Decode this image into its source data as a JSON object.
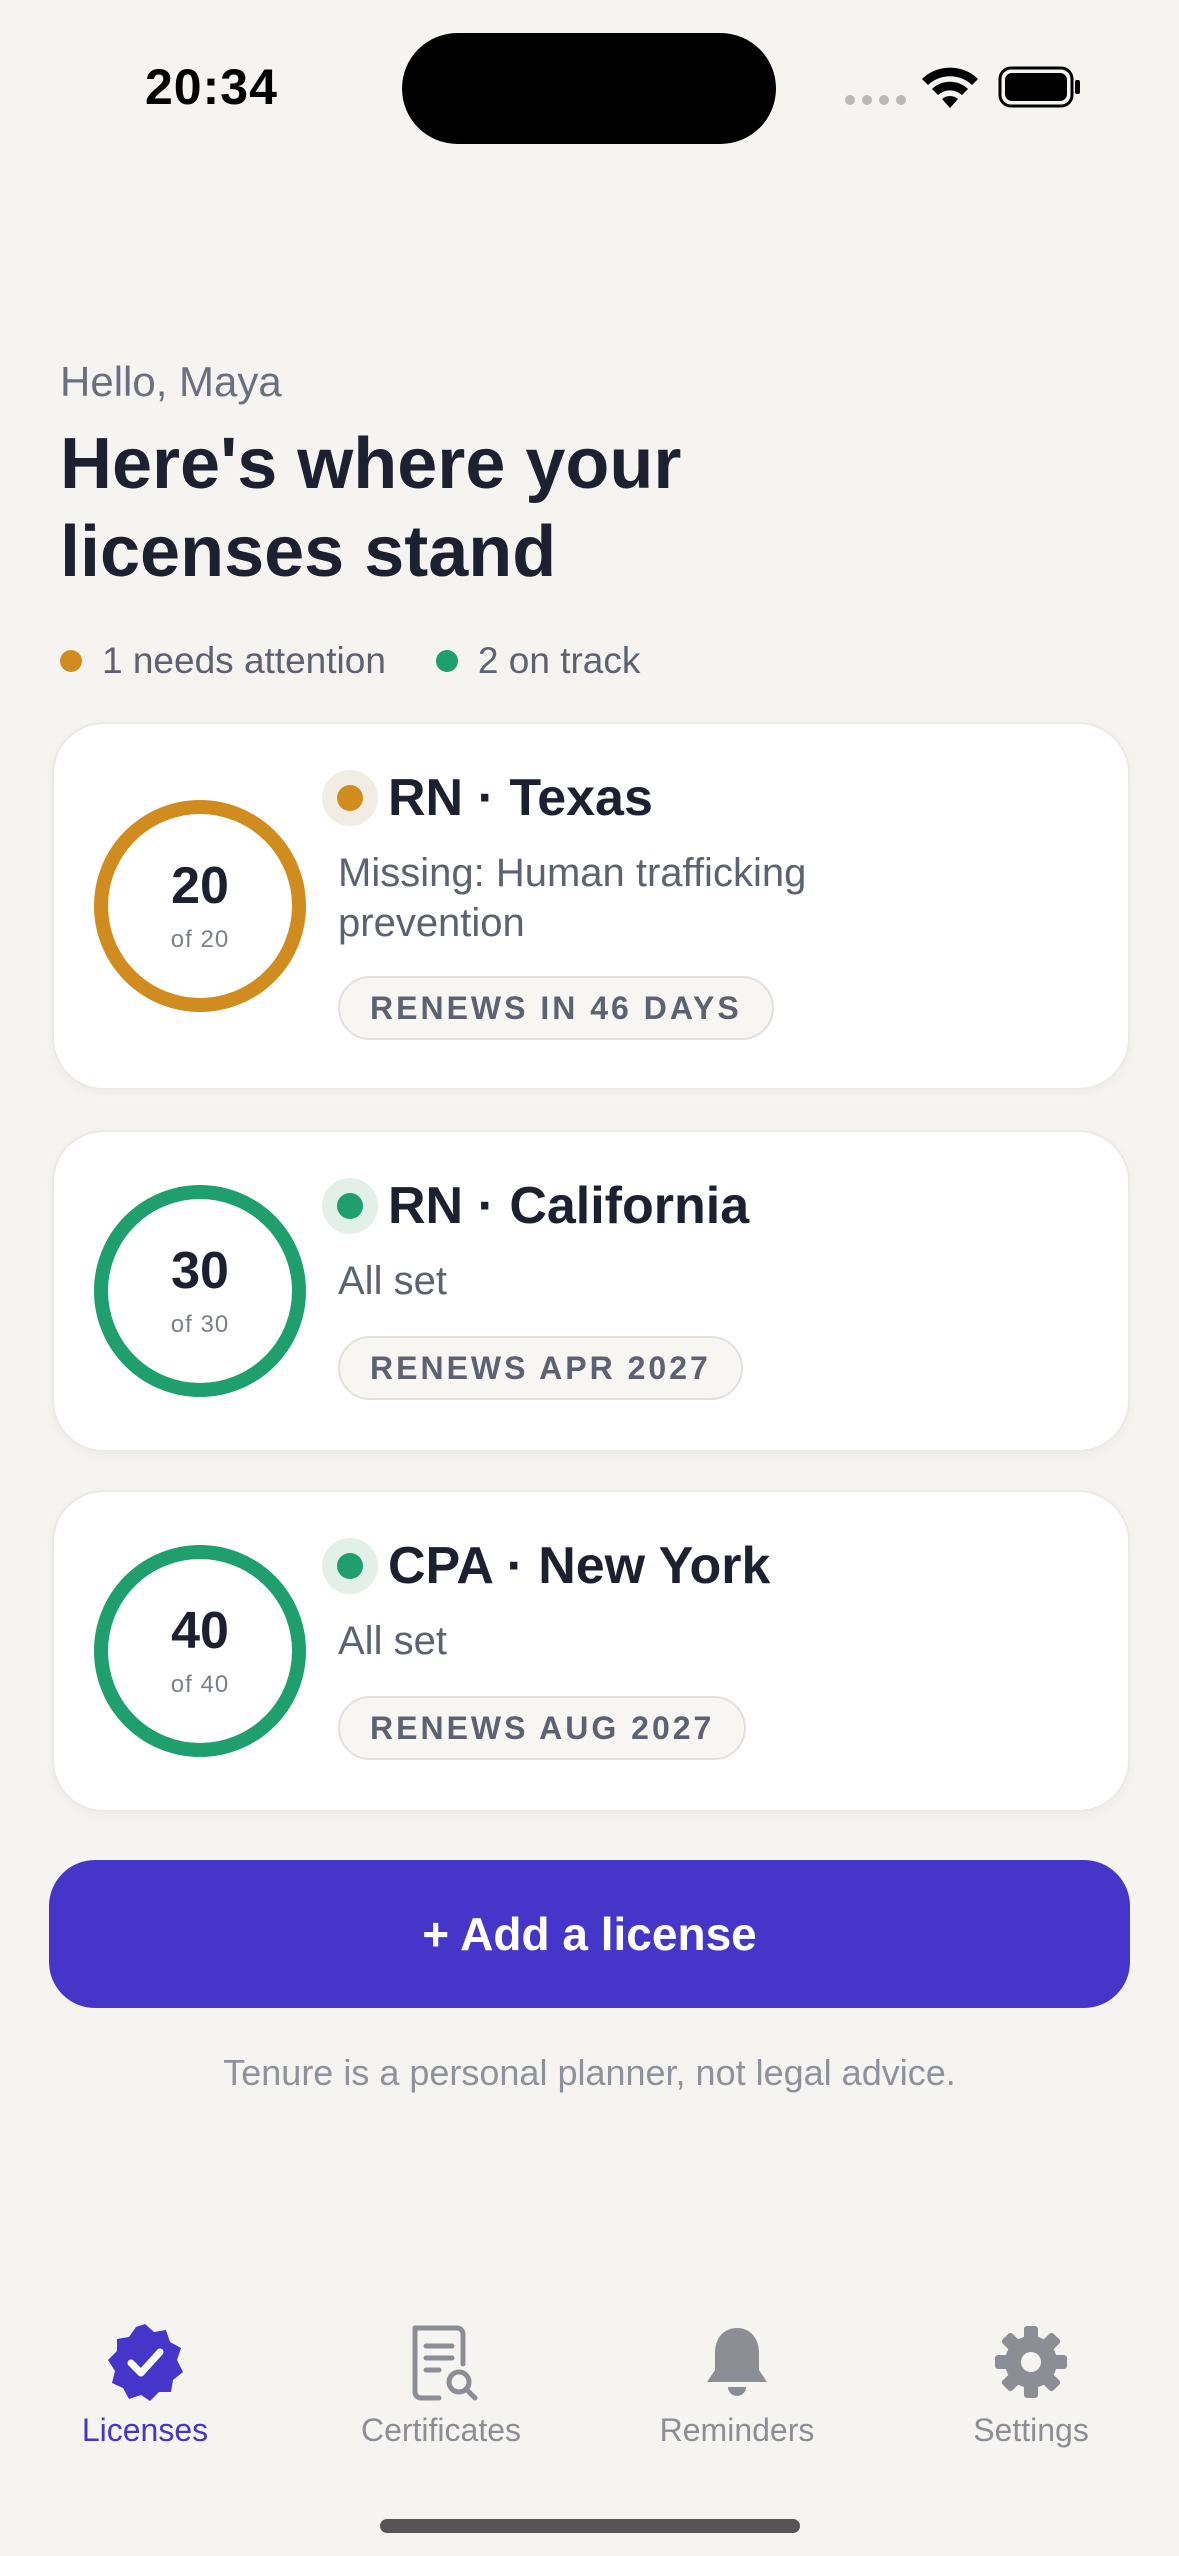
{
  "status_bar": {
    "time": "20:34"
  },
  "header": {
    "greeting": "Hello, Maya",
    "headline": "Here's where your licenses stand",
    "summary": [
      {
        "label": "1 needs attention",
        "color": "#d08c1e"
      },
      {
        "label": "2 on track",
        "color": "#1f9e6e"
      }
    ]
  },
  "licenses": [
    {
      "count": "20",
      "of": "of 20",
      "title": "RN · Texas",
      "subtitle": "Missing: Human trafficking prevention",
      "renewal": "RENEWS IN 46 DAYS",
      "status": "attention",
      "color": "#d08c1e",
      "progress": 1.0
    },
    {
      "count": "30",
      "of": "of 30",
      "title": "RN · California",
      "subtitle": "All set",
      "renewal": "RENEWS APR 2027",
      "status": "on-track",
      "color": "#1f9e6e",
      "progress": 1.0
    },
    {
      "count": "40",
      "of": "of 40",
      "title": "CPA · New York",
      "subtitle": "All set",
      "renewal": "RENEWS AUG 2027",
      "status": "on-track",
      "color": "#1f9e6e",
      "progress": 1.0
    }
  ],
  "actions": {
    "add_license": "+ Add a license"
  },
  "disclaimer": "Tenure is a personal planner, not legal advice.",
  "tabs": [
    {
      "label": "Licenses",
      "icon": "verified-badge-icon",
      "active": true
    },
    {
      "label": "Certificates",
      "icon": "certificate-search-icon",
      "active": false
    },
    {
      "label": "Reminders",
      "icon": "bell-icon",
      "active": false
    },
    {
      "label": "Settings",
      "icon": "gear-icon",
      "active": false
    }
  ],
  "colors": {
    "accent": "#4535c8",
    "attention": "#d08c1e",
    "on_track": "#1f9e6e",
    "background": "#f5f4f0"
  }
}
